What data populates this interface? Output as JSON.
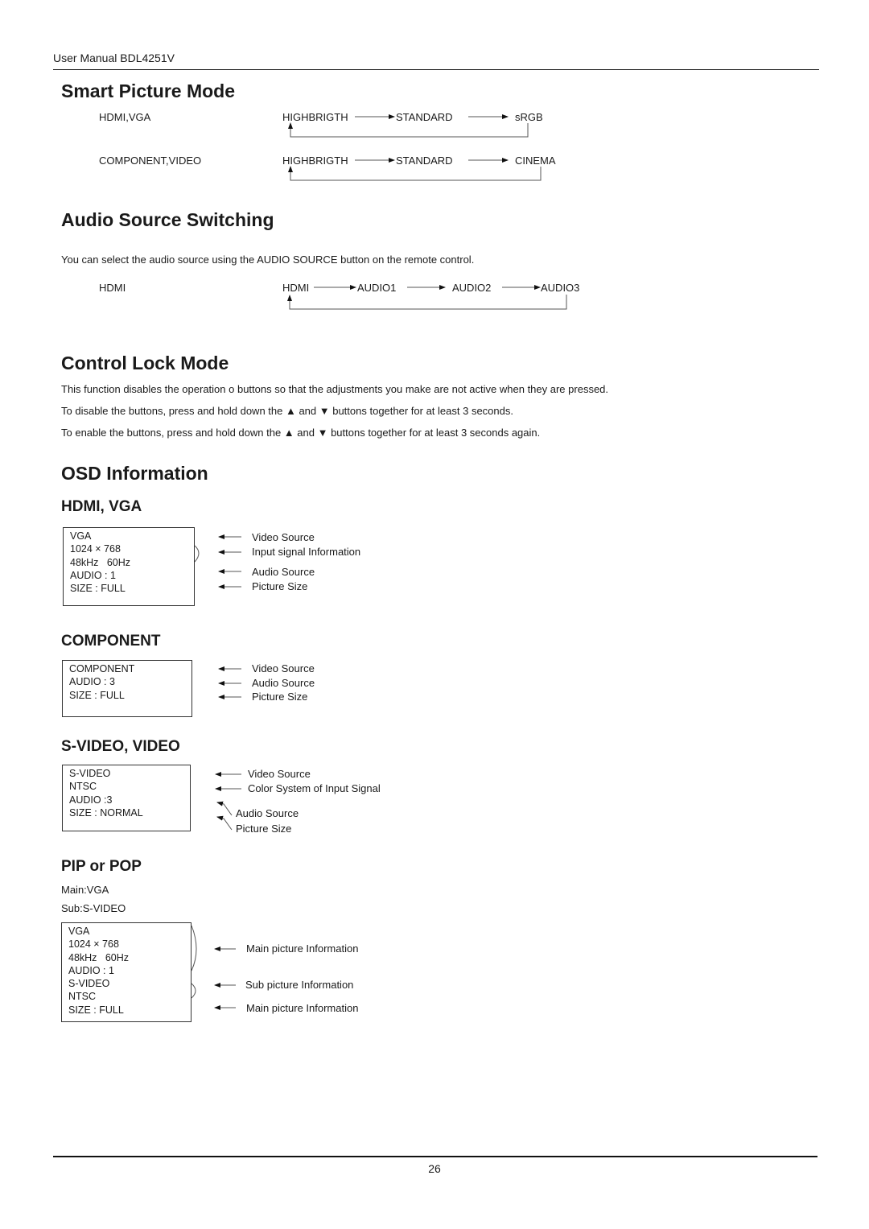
{
  "header": {
    "title": "User Manual BDL4251V"
  },
  "smart_picture": {
    "heading": "Smart Picture Mode",
    "rows": [
      {
        "source": "HDMI,VGA",
        "steps": [
          "HIGHBRIGTH",
          "STANDARD",
          "sRGB"
        ]
      },
      {
        "source": "COMPONENT,VIDEO",
        "steps": [
          "HIGHBRIGTH",
          "STANDARD",
          "CINEMA"
        ]
      }
    ]
  },
  "audio_source": {
    "heading": "Audio Source Switching",
    "description": "You can select the audio source using the AUDIO SOURCE button on the remote control.",
    "row": {
      "source": "HDMI",
      "steps": [
        "HDMI",
        "AUDIO1",
        "AUDIO2",
        "AUDIO3"
      ]
    }
  },
  "control_lock": {
    "heading": "Control Lock Mode",
    "paragraphs": [
      "This function disables the operation o buttons so that the adjustments you make are not active when they are pressed.",
      "To disable the buttons, press and hold down the ▲ and ▼ buttons together for at least 3 seconds.",
      "To enable the buttons, press and hold down the ▲ and ▼ buttons together for at least 3 seconds again."
    ]
  },
  "osd": {
    "heading": "OSD Information",
    "hdmi_vga": {
      "heading": "HDMI, VGA",
      "box": [
        "VGA",
        "1024 × 768",
        "48kHz   60Hz",
        "AUDIO : 1",
        "SIZE : FULL"
      ],
      "labels": [
        "Video Source",
        "Input signal Information",
        "Audio Source",
        "Picture Size"
      ]
    },
    "component": {
      "heading": "COMPONENT",
      "box": [
        "COMPONENT",
        "AUDIO : 3",
        "SIZE : FULL"
      ],
      "labels": [
        "Video Source",
        "Audio Source",
        "Picture Size"
      ]
    },
    "svideo": {
      "heading": "S-VIDEO, VIDEO",
      "box": [
        "S-VIDEO",
        "NTSC",
        "AUDIO :3",
        "SIZE : NORMAL"
      ],
      "labels": [
        "Video Source",
        "Color System of Input Signal",
        "Audio Source",
        "Picture Size"
      ]
    },
    "pip": {
      "heading": "PIP or POP",
      "main": "Main:VGA",
      "sub": "Sub:S-VIDEO",
      "box": [
        "VGA",
        "1024 × 768",
        "48kHz   60Hz",
        "AUDIO : 1",
        "S-VIDEO",
        "NTSC",
        "SIZE : FULL"
      ],
      "labels": [
        "Main picture Information",
        "Sub picture Information",
        "Main picture Information"
      ]
    }
  },
  "footer": {
    "page_number": "26"
  }
}
